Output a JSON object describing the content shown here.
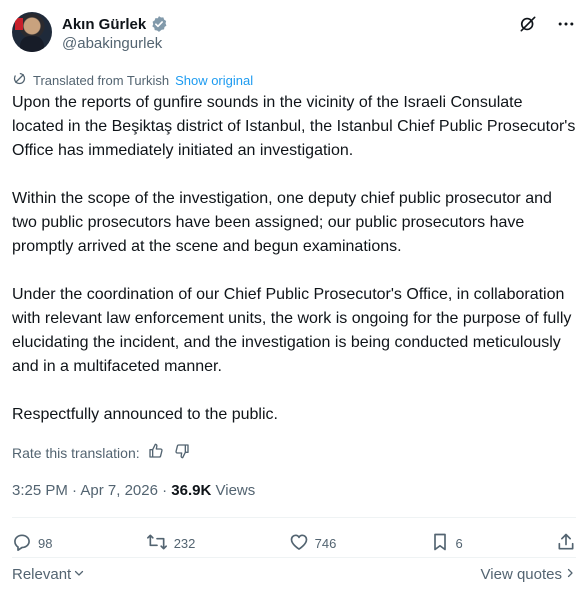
{
  "author": {
    "name": "Akın Gürlek",
    "handle": "@abakingurlek"
  },
  "translation": {
    "note": "Translated from Turkish",
    "show_original": "Show original"
  },
  "post": {
    "paragraphs": [
      "Upon the reports of gunfire sounds in the vicinity of the Israeli Consulate located in the Beşiktaş district of Istanbul, the Istanbul Chief Public Prosecutor's Office has immediately initiated an investigation.",
      "Within the scope of the investigation, one deputy chief public prosecutor and two public prosecutors have been assigned; our public prosecutors have promptly arrived at the scene and begun examinations.",
      "Under the coordination of our Chief Public Prosecutor's Office, in collaboration with relevant law enforcement units, the work is ongoing for the purpose of fully elucidating the incident, and the investigation is being conducted meticulously and in a multifaceted manner.",
      "Respectfully announced to the public."
    ]
  },
  "rate": {
    "label": "Rate this translation:"
  },
  "meta": {
    "time": "3:25 PM",
    "separator": "·",
    "date": "Apr 7, 2026",
    "views_count": "36.9K",
    "views_label": "Views"
  },
  "actions": {
    "replies": "98",
    "reposts": "232",
    "likes": "746",
    "bookmarks": "6"
  },
  "footer": {
    "sort_label": "Relevant",
    "quotes_label": "View quotes"
  },
  "colors": {
    "text": "#0f1419",
    "secondary": "#536471",
    "link": "#1d9bf0",
    "verified": "#829aab",
    "divider": "#eff3f4"
  }
}
